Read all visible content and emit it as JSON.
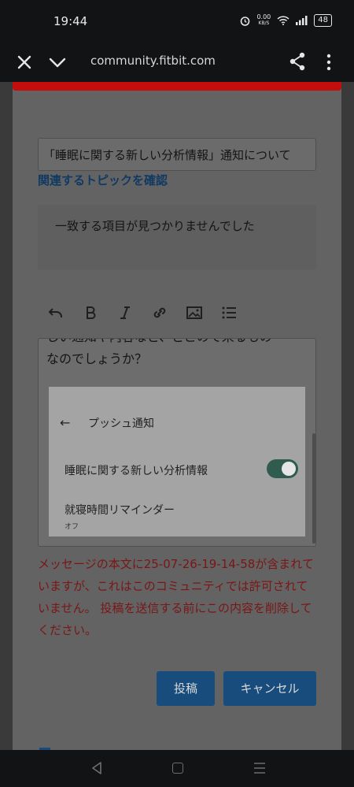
{
  "status_bar": {
    "time": "19:44",
    "network_speed_value": "0.00",
    "network_speed_unit": "KB/S",
    "battery": "48",
    "icons": [
      "alarm-icon",
      "wifi-icon",
      "signal-icon",
      "battery-icon"
    ]
  },
  "browser": {
    "url": "community.fitbit.com",
    "icons": [
      "close-icon",
      "chevron-down-icon",
      "share-icon",
      "more-vert-icon"
    ]
  },
  "form": {
    "subject_value": "「睡眠に関する新しい分析情報」通知について",
    "related_topics_title": "関連するトピックを確認",
    "related_topics_empty": "一致する項目が見つかりませんでした",
    "toolbar": [
      "undo-icon",
      "bold-icon",
      "italic-icon",
      "link-icon",
      "image-icon",
      "list-icon"
    ],
    "editor_text_partial": "しい通知や内容など、どこので来るもの",
    "editor_text": "なのでしょうか？",
    "embedded_screenshot": {
      "title": "プッシュ通知",
      "item1": "睡眠に関する新しい分析情報",
      "item2": "就寝時間リマインダー",
      "item2_sub": "オフ",
      "item1_toggle_on": true
    },
    "error_message": "メッセージの本文に25-07-26-19-14-58が含まれていますが、これはこのコミュニティでは許可されていません。 投稿を送信する前にこの内容を削除してください。",
    "post_button": "投稿",
    "cancel_button": "キャンセル"
  },
  "colors": {
    "accent": "#174c7d",
    "link": "#103a63",
    "error": "#7a1616",
    "alert_strip": "#c40d0d",
    "toggle_on": "#2f5c4e"
  }
}
